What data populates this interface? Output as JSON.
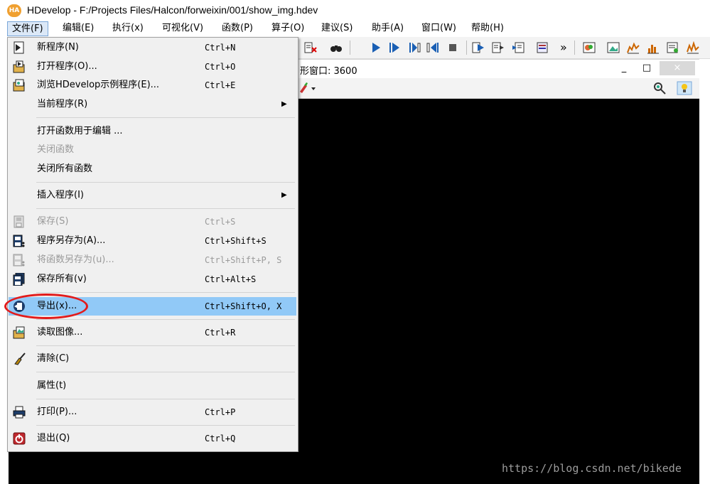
{
  "window": {
    "title": "HDevelop - F:/Projects Files/Halcon/forweixin/001/show_img.hdev",
    "logo_text": "HA"
  },
  "menubar": [
    {
      "label": "文件(F)"
    },
    {
      "label": "编辑(E)"
    },
    {
      "label": "执行(x)"
    },
    {
      "label": "可视化(V)"
    },
    {
      "label": "函数(P)"
    },
    {
      "label": "算子(O)"
    },
    {
      "label": "建议(S)"
    },
    {
      "label": "助手(A)"
    },
    {
      "label": "窗口(W)"
    },
    {
      "label": "帮助(H)"
    }
  ],
  "toolbar": {
    "overflow": "»"
  },
  "graphics_window": {
    "title": "形窗口: 3600",
    "minimize": "_",
    "maximize": "□",
    "close": "×"
  },
  "file_menu": {
    "items": [
      {
        "label": "新程序(N)",
        "shortcut": "Ctrl+N"
      },
      {
        "label": "打开程序(O)...",
        "shortcut": "Ctrl+O"
      },
      {
        "label": "浏览HDevelop示例程序(E)...",
        "shortcut": "Ctrl+E"
      },
      {
        "label": "当前程序(R)",
        "shortcut": "",
        "submenu": "▶"
      },
      {
        "label": "打开函数用于编辑 ...",
        "shortcut": ""
      },
      {
        "label": "关闭函数",
        "shortcut": ""
      },
      {
        "label": "关闭所有函数",
        "shortcut": ""
      },
      {
        "label": "插入程序(I)",
        "shortcut": "",
        "submenu": "▶"
      },
      {
        "label": "保存(S)",
        "shortcut": "Ctrl+S"
      },
      {
        "label": "程序另存为(A)...",
        "shortcut": "Ctrl+Shift+S"
      },
      {
        "label": "将函数另存为(u)...",
        "shortcut": "Ctrl+Shift+P, S"
      },
      {
        "label": "保存所有(v)",
        "shortcut": "Ctrl+Alt+S"
      },
      {
        "label": "导出(x)...",
        "shortcut": "Ctrl+Shift+O, X"
      },
      {
        "label": "读取图像...",
        "shortcut": "Ctrl+R"
      },
      {
        "label": "清除(C)",
        "shortcut": ""
      },
      {
        "label": "属性(t)",
        "shortcut": ""
      },
      {
        "label": "打印(P)...",
        "shortcut": "Ctrl+P"
      },
      {
        "label": "退出(Q)",
        "shortcut": "Ctrl+Q"
      }
    ]
  },
  "watermark": "https://blog.csdn.net/bikede",
  "colors": {
    "highlight": "#91c9f7",
    "annotation_ring": "#e21b1b",
    "canvas": "#000000"
  }
}
